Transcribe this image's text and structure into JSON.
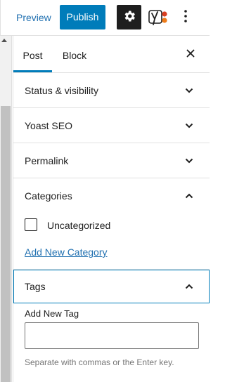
{
  "toolbar": {
    "preview_label": "Preview",
    "publish_label": "Publish",
    "settings_icon": "gear-icon",
    "yoast_icon": "yoast-icon",
    "more_icon": "vertical-ellipsis-icon"
  },
  "colors": {
    "accent": "#007cba",
    "link": "#2271b1",
    "dark": "#1e1e1e",
    "yoast_red": "#d93f21",
    "yoast_orange": "#ee7c1b"
  },
  "sidebar": {
    "tabs": [
      {
        "label": "Post",
        "active": true
      },
      {
        "label": "Block",
        "active": false
      }
    ],
    "close_icon": "close-icon",
    "sections": {
      "status": {
        "title": "Status & visibility",
        "expanded": false
      },
      "yoast": {
        "title": "Yoast SEO",
        "expanded": false
      },
      "permalink": {
        "title": "Permalink",
        "expanded": false
      },
      "categories": {
        "title": "Categories",
        "expanded": true,
        "items": [
          {
            "label": "Uncategorized",
            "checked": false
          }
        ],
        "add_link": "Add New Category"
      },
      "tags": {
        "title": "Tags",
        "expanded": true,
        "field_label": "Add New Tag",
        "value": "",
        "help": "Separate with commas or the Enter key."
      }
    }
  }
}
